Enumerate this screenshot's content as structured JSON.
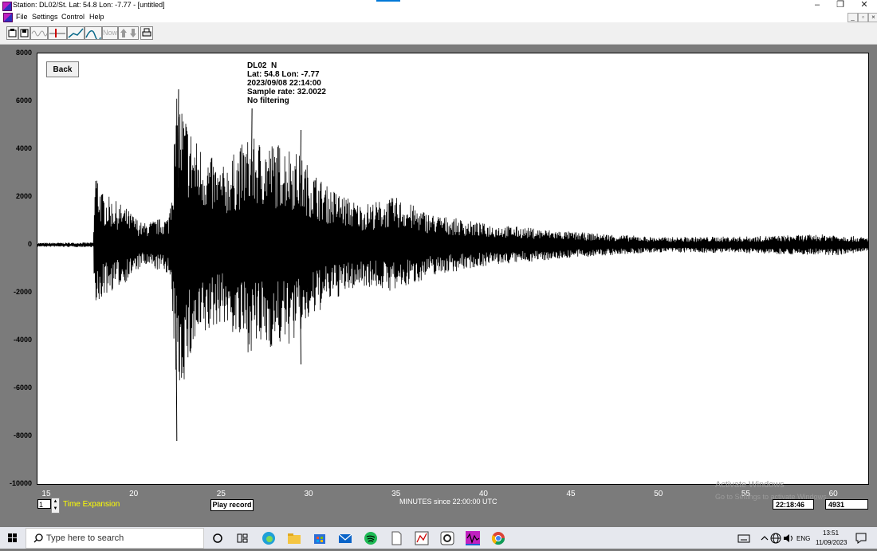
{
  "window": {
    "title": "Station: DL02/St. Lat: 54.8 Lon: -7.77 - [untitled]",
    "controls": {
      "minimize": "–",
      "restore": "❐",
      "close": "✕"
    }
  },
  "menu": {
    "items": [
      "File",
      "Settings",
      "Control",
      "Help"
    ],
    "mdi": {
      "minimize": "_",
      "restore": "▫",
      "close": "×"
    }
  },
  "toolbar": {
    "now_label": "Now",
    "icons": [
      "open-icon",
      "save-icon",
      "waveform-icon",
      "pick-icon",
      "trend-icon",
      "peak-icon",
      "now-button",
      "scroll-icon",
      "print-icon"
    ]
  },
  "info": {
    "station": "DL02  N",
    "location": "Lat: 54.8 Lon: -7.77",
    "datetime": "2023/09/08 22:14:00",
    "sample_rate": "Sample rate: 32.0022",
    "filter": "No filtering"
  },
  "controls": {
    "back": "Back",
    "expansion_value": "1",
    "time_expansion_label": "Time Expansion",
    "play_record": "Play record",
    "cursor_time": "22:18:46",
    "cursor_value": "4931"
  },
  "chart_data": {
    "type": "line",
    "title": "",
    "xlabel": "MINUTES since 22:00:00 UTC",
    "ylabel": "",
    "xlim": [
      14.5,
      62
    ],
    "ylim": [
      -10000,
      8000
    ],
    "yticks": [
      "8000",
      "6000",
      "4000",
      "2000",
      "0",
      "-2000",
      "-4000",
      "-6000",
      "-8000",
      "-10000"
    ],
    "xticks": [
      "15",
      "20",
      "25",
      "30",
      "35",
      "40",
      "45",
      "50",
      "55",
      "60"
    ],
    "grid": false,
    "series": [
      {
        "color": "#000000",
        "envelope": [
          {
            "t": 14.5,
            "amp": 80
          },
          {
            "t": 17.7,
            "amp": 100
          },
          {
            "t": 17.8,
            "amp": 3500
          },
          {
            "t": 18.2,
            "amp": 2200
          },
          {
            "t": 19.5,
            "amp": 1600
          },
          {
            "t": 20.5,
            "amp": 900
          },
          {
            "t": 22.0,
            "amp": 1200
          },
          {
            "t": 22.5,
            "amp": 6500
          },
          {
            "t": 23.5,
            "amp": 4500
          },
          {
            "t": 25.0,
            "amp": 3200
          },
          {
            "t": 26.5,
            "amp": 4500
          },
          {
            "t": 29.0,
            "amp": 4200
          },
          {
            "t": 31.0,
            "amp": 2500
          },
          {
            "t": 33.0,
            "amp": 1700
          },
          {
            "t": 35.0,
            "amp": 2000
          },
          {
            "t": 37.0,
            "amp": 1300
          },
          {
            "t": 40.0,
            "amp": 900
          },
          {
            "t": 45.0,
            "amp": 550
          },
          {
            "t": 50.0,
            "amp": 320
          },
          {
            "t": 55.0,
            "amp": 350
          },
          {
            "t": 60.0,
            "amp": 450
          },
          {
            "t": 62.0,
            "amp": 300
          }
        ],
        "peaks": [
          {
            "t": 22.4,
            "value": -8200
          },
          {
            "t": 22.5,
            "value": 6500
          },
          {
            "t": 26.7,
            "value": 5700
          },
          {
            "t": 29.5,
            "value": 4800
          },
          {
            "t": 29.5,
            "value": -5000
          }
        ]
      }
    ]
  },
  "watermark": {
    "line1": "Activate Windows",
    "line2": "Go to Settings to activate Windows."
  },
  "taskbar": {
    "search_placeholder": "Type here to search",
    "language": "ENG",
    "time": "13:51",
    "date": "11/09/2023"
  }
}
